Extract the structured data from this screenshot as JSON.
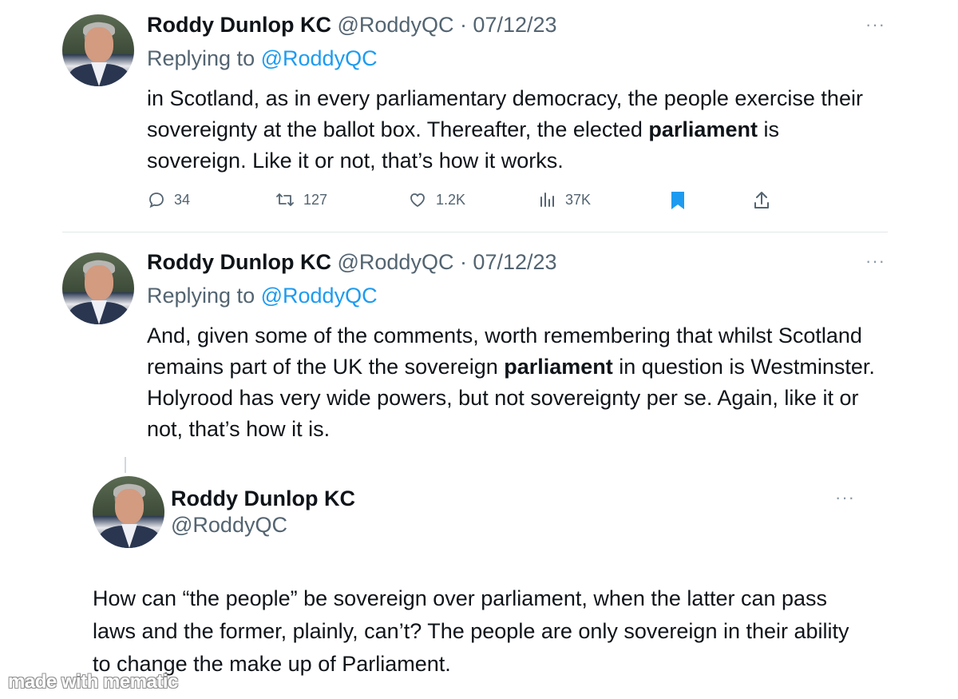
{
  "tweet1": {
    "author": "Roddy Dunlop KC",
    "meta": "@RoddyQC · 07/12/23",
    "replying_prefix": "Replying to",
    "replying_handle": "@RoddyQC",
    "text_before": "in Scotland, as in every parliamentary democracy, the people exercise their sovereignty at the ballot box. Thereafter, the elected ",
    "text_bold": "parliament",
    "text_after": " is sovereign. Like it or not, that’s how it works.",
    "more": "···",
    "actions": {
      "replies": "34",
      "reposts": "127",
      "likes": "1.2K",
      "views": "37K"
    }
  },
  "tweet2": {
    "author": "Roddy Dunlop KC",
    "meta": "@RoddyQC · 07/12/23",
    "replying_prefix": "Replying to",
    "replying_handle": "@RoddyQC",
    "text_before": "And, given some of the comments, worth remembering that whilst Scotland remains part of the UK the sovereign ",
    "text_bold": "parliament",
    "text_after": " in question is Westminster. Holyrood has very wide powers, but not sovereignty per se. Again, like it or not, that’s how it is.",
    "more": "···"
  },
  "tweet3": {
    "author": "Roddy Dunlop KC",
    "handle": "@RoddyQC",
    "more": "···",
    "text": "How can “the people” be sovereign over parliament, when the latter can pass laws and the former, plainly, can’t? The people are only sovereign in their ability to change the make up of Parliament."
  },
  "watermark": "made with mematic",
  "colors": {
    "accent": "#1d9bf0",
    "secondary_text": "#536471",
    "primary_text": "#0f1419"
  },
  "icons": [
    "reply-icon",
    "repost-icon",
    "like-icon",
    "views-icon",
    "bookmark-icon",
    "share-icon",
    "more-icon"
  ]
}
